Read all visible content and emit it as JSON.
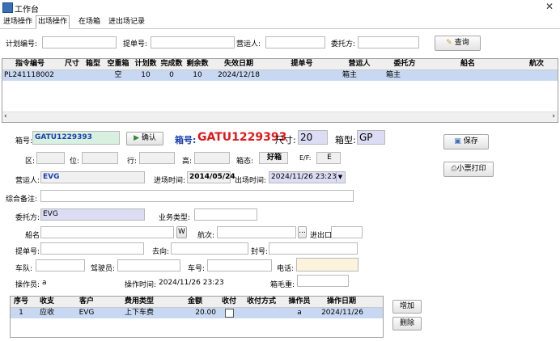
{
  "window": {
    "title": "工作台"
  },
  "tabs": [
    "进场操作",
    "出场操作",
    "在场箱",
    "进出场记录"
  ],
  "search": {
    "plan_no_label": "计划编号:",
    "bill_no_label": "提单号:",
    "carrier_label": "营运人:",
    "client_label": "委托方:",
    "query_button": "查询"
  },
  "top_grid": {
    "headers": [
      "指令编号",
      "尺寸",
      "箱型",
      "空重箱",
      "计划数",
      "完成数",
      "剩余数",
      "失效日期",
      "提单号",
      "营运人",
      "委托方",
      "船名",
      "航次"
    ],
    "row": {
      "order_no": "PL241118002",
      "empty_full": "空",
      "plan_count": "10",
      "done_count": "0",
      "remain_count": "10",
      "expire_date": "2024/12/18",
      "carrier": "箱主",
      "client": "箱主"
    }
  },
  "form": {
    "container_no_label": "箱号:",
    "container_no_value": "GATU1229393",
    "confirm_button": "确认",
    "container_no_big_label": "箱号:",
    "container_no_big_value": "GATU1229393",
    "size_label": "尺寸:",
    "size_value": "20",
    "type_label": "箱型:",
    "type_value": "GP",
    "save_button": "保存",
    "print_button": "小票打印",
    "area_label": "区:",
    "bay_label": "位:",
    "row_label": "行:",
    "tier_label": "高:",
    "status_label": "箱态:",
    "status_value": "好箱",
    "ef_label": "E/F:",
    "ef_value": "E",
    "carrier_label": "营运人:",
    "carrier_value": "EVG",
    "in_time_label": "进场时间:",
    "in_time_value": "2014/05/24",
    "out_time_label": "出场时间:",
    "out_time_value": "2024/11/26 23:23",
    "remark_label": "综合备注:",
    "client_label": "委托方:",
    "client_value": "EVG",
    "biz_type_label": "业务类型:",
    "vessel_label": "船名:",
    "vessel_btn": "W",
    "voyage_label": "航次:",
    "voyage_btn": "...",
    "port_label": "进出口:",
    "bill_label": "提单号:",
    "dest_label": "去向:",
    "seal_label": "封号:",
    "team_label": "车队:",
    "driver_label": "驾驶员:",
    "truck_label": "车号:",
    "phone_label": "电话:",
    "operator_label": "操作员:",
    "operator_value": "a",
    "op_time_label": "操作时间:",
    "op_time_value": "2024/11/26 23:23",
    "gross_label": "箱毛重:"
  },
  "fee_grid": {
    "headers": [
      "序号",
      "收支",
      "客户",
      "费用类型",
      "金额",
      "收付",
      "收付方式",
      "操作员",
      "操作日期"
    ],
    "row": {
      "seq": "1",
      "type": "应收",
      "customer": "EVG",
      "fee_type": "上下车费",
      "amount": "20.00",
      "method": "",
      "operator": "a",
      "date": "2024/11/26"
    }
  },
  "fee_buttons": {
    "add": "增加",
    "delete": "删除"
  }
}
